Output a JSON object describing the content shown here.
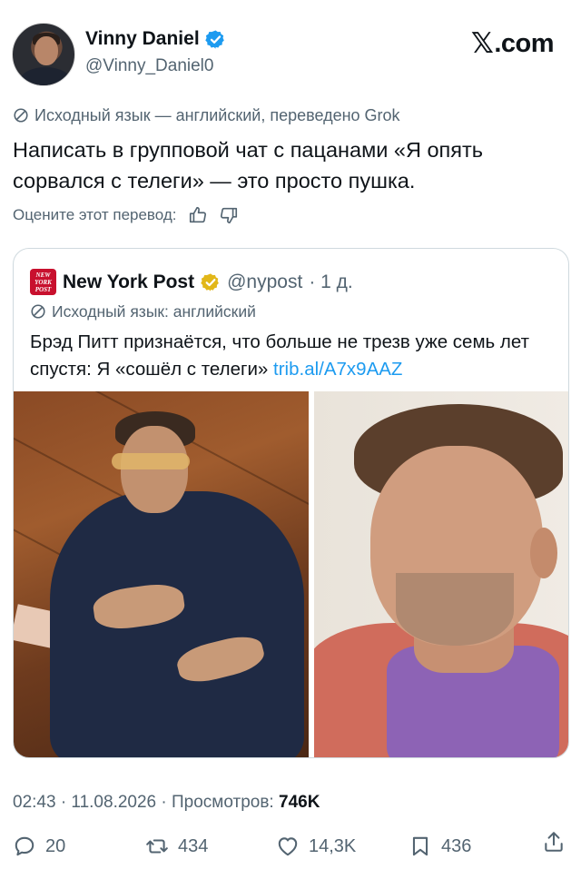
{
  "author": {
    "name": "Vinny Daniel",
    "handle": "@Vinny_Daniel0",
    "verified": true,
    "avatar_icon": "user-avatar"
  },
  "site_logo": {
    "glyph": "𝕏",
    "text": ".com"
  },
  "translation_note": "Исходный язык — английский, переведено Grok",
  "tweet_text": "Написать в групповой чат с пацанами «Я опять сорвался с телеги» — это просто пушка.",
  "rate_translation": {
    "label": "Оцените этот перевод:",
    "icons": [
      "thumbs-up-icon",
      "thumbs-down-icon"
    ]
  },
  "quote": {
    "logo_text": "NEW YORK POST",
    "name": "New York Post",
    "handle": "@nypost",
    "time": "· 1 д.",
    "verified_gold": true,
    "translation_note": "Исходный язык: английский",
    "text": "Брэд Питт признаётся, что больше не трезв уже семь лет спустя: Я «сошёл с телеги» ",
    "link": "trib.al/A7x9AAZ",
    "images": [
      "photo-lying-on-floor",
      "photo-portrait"
    ]
  },
  "meta": {
    "time_date": "02:43 · 11.08.2026 · Просмотров: ",
    "views": "746K"
  },
  "actions": {
    "replies": "20",
    "reposts": "434",
    "likes": "14,3K",
    "bookmarks": "436"
  },
  "colors": {
    "text": "#0f1419",
    "secondary": "#536471",
    "link": "#1d9bf0",
    "verified_blue": "#1d9bf0",
    "verified_gold": "#e2b719",
    "nyp_red": "#c8102e"
  }
}
